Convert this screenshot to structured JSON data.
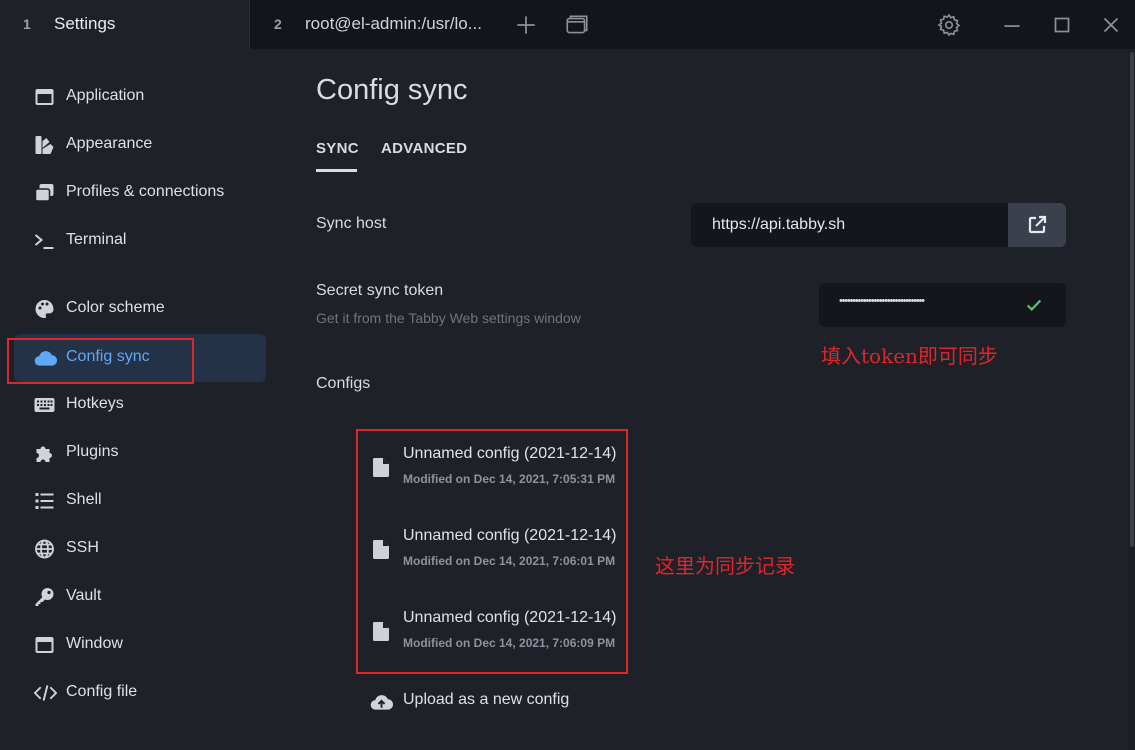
{
  "tabs": [
    {
      "number": "1",
      "title": "Settings"
    },
    {
      "number": "2",
      "title": "root@el-admin:/usr/lo..."
    }
  ],
  "titlebar_icons": [
    "plus-icon",
    "window-restore-icon",
    "gear-icon",
    "minimize-icon",
    "maximize-icon",
    "close-icon"
  ],
  "sidebar": {
    "items": [
      {
        "label": "Application",
        "icon": "application-icon"
      },
      {
        "label": "Appearance",
        "icon": "appearance-icon"
      },
      {
        "label": "Profiles & connections",
        "icon": "profiles-icon"
      },
      {
        "label": "Terminal",
        "icon": "terminal-icon"
      },
      {
        "label": "Color scheme",
        "icon": "palette-icon"
      },
      {
        "label": "Config sync",
        "icon": "cloud-icon",
        "active": true
      },
      {
        "label": "Hotkeys",
        "icon": "keyboard-icon"
      },
      {
        "label": "Plugins",
        "icon": "puzzle-icon"
      },
      {
        "label": "Shell",
        "icon": "list-icon"
      },
      {
        "label": "SSH",
        "icon": "globe-icon"
      },
      {
        "label": "Vault",
        "icon": "key-icon"
      },
      {
        "label": "Window",
        "icon": "window-icon"
      },
      {
        "label": "Config file",
        "icon": "code-icon"
      }
    ]
  },
  "main": {
    "title": "Config sync",
    "subtabs": [
      {
        "label": "SYNC",
        "active": true
      },
      {
        "label": "ADVANCED",
        "active": false
      }
    ],
    "sync_host": {
      "label": "Sync host",
      "value": "https://api.tabby.sh"
    },
    "secret_token": {
      "label": "Secret sync token",
      "hint": "Get it from the Tabby Web settings window",
      "masked_value": "••••••••••••••••••••••••••••••••"
    },
    "configs": {
      "label": "Configs",
      "items": [
        {
          "name": "Unnamed config (2021-12-14)",
          "modified": "Modified on Dec 14, 2021, 7:05:31 PM"
        },
        {
          "name": "Unnamed config (2021-12-14)",
          "modified": "Modified on Dec 14, 2021, 7:06:01 PM"
        },
        {
          "name": "Unnamed config (2021-12-14)",
          "modified": "Modified on Dec 14, 2021, 7:06:09 PM"
        }
      ]
    },
    "upload_label": "Upload as a new config"
  },
  "annotations": {
    "token_note": "填入token即可同步",
    "records_note": "这里为同步记录"
  },
  "colors": {
    "background": "#1e2128",
    "tabbar": "#13151a",
    "accent": "#5fa8f5",
    "active_item_bg": "#233246",
    "annotation_red": "#e0262b",
    "success_green": "#4ecb71"
  }
}
